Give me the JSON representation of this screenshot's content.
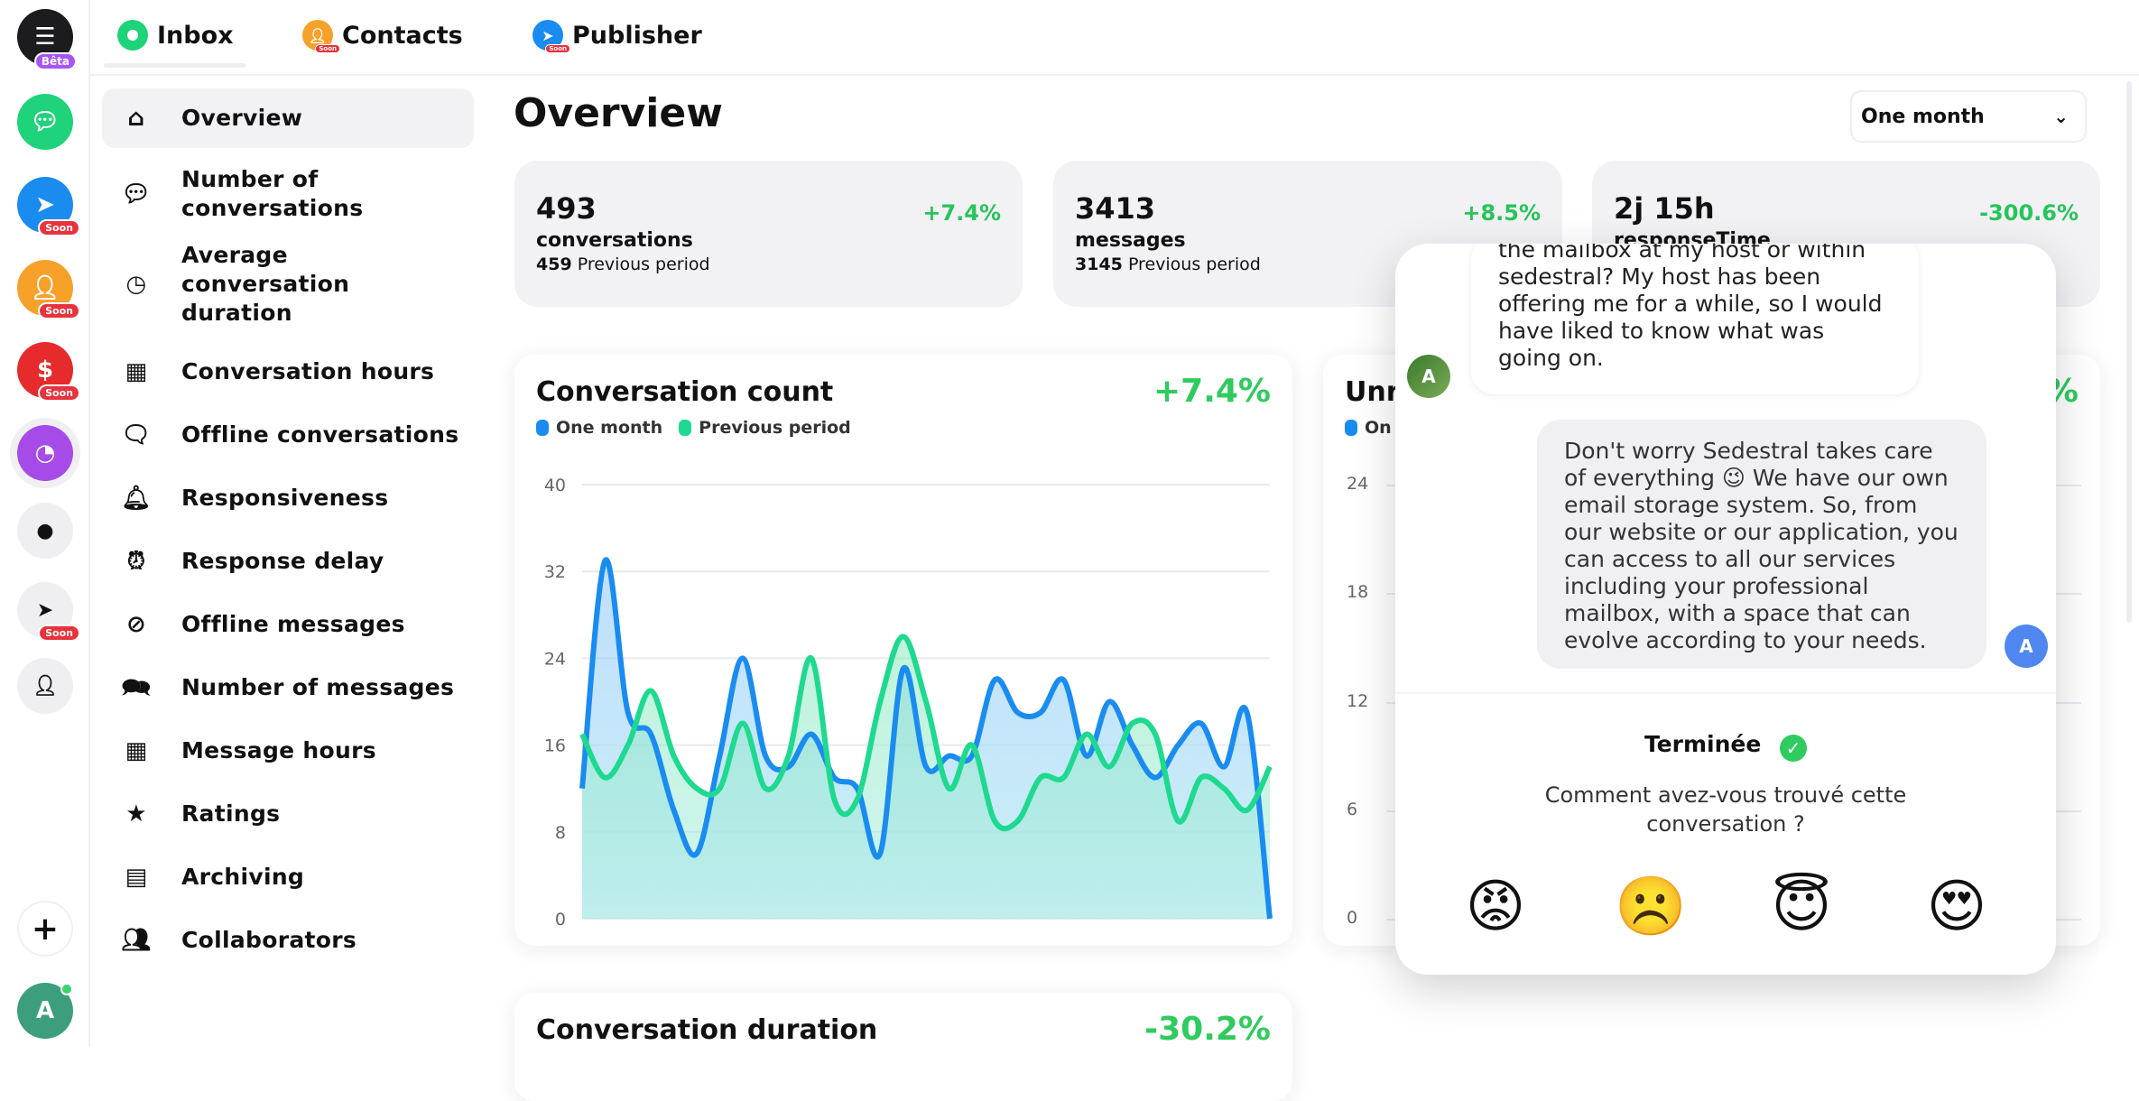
{
  "rail": {
    "beta_badge": "Bêta",
    "soon": "Soon",
    "user_initial": "A",
    "add": "+"
  },
  "topnav": {
    "tabs": [
      {
        "label": "Inbox"
      },
      {
        "label": "Contacts",
        "badge": "Soon"
      },
      {
        "label": "Publisher",
        "badge": "Soon"
      }
    ]
  },
  "sidebar": {
    "items": [
      {
        "label": "Overview",
        "icon": "home-user-icon"
      },
      {
        "label": "Number of conversations",
        "icon": "chat-bubbles-icon"
      },
      {
        "label": "Average conversation duration",
        "icon": "clock-icon"
      },
      {
        "label": "Conversation hours",
        "icon": "calendar-chart-icon"
      },
      {
        "label": "Offline conversations",
        "icon": "chat-x-icon"
      },
      {
        "label": "Responsiveness",
        "icon": "bell-icon"
      },
      {
        "label": "Response delay",
        "icon": "alarm-icon"
      },
      {
        "label": "Offline messages",
        "icon": "chat-blocked-icon"
      },
      {
        "label": "Number of messages",
        "icon": "chat-trend-icon"
      },
      {
        "label": "Message hours",
        "icon": "calendar-bell-icon"
      },
      {
        "label": "Ratings",
        "icon": "user-stars-icon"
      },
      {
        "label": "Archiving",
        "icon": "archive-icon"
      },
      {
        "label": "Collaborators",
        "icon": "team-icon"
      }
    ]
  },
  "main": {
    "title": "Overview",
    "period_select": "One month",
    "stats": [
      {
        "value": "493",
        "label": "conversations",
        "prev_value": "459",
        "prev_label": "Previous period",
        "change": "+7.4%"
      },
      {
        "value": "3413",
        "label": "messages",
        "prev_value": "3145",
        "prev_label": "Previous period",
        "change": "+8.5%"
      },
      {
        "value": "2j 15h",
        "label": "responseTime",
        "change": "-300.6%"
      }
    ],
    "second_chart": {
      "title": "Unr",
      "legend": "On",
      "change": "%",
      "yticks": [
        "24",
        "18",
        "12",
        "6",
        "0"
      ]
    },
    "third_chart": {
      "title": "Conversation duration",
      "change": "-30.2%"
    }
  },
  "chart_data": {
    "type": "area",
    "title": "Conversation count",
    "change": "+7.4%",
    "xlabel": "",
    "ylabel": "",
    "ylim": [
      0,
      40
    ],
    "yticks": [
      "40",
      "32",
      "24",
      "16",
      "8",
      "0"
    ],
    "grid": true,
    "legend_position": "top-left",
    "x": [
      1,
      2,
      3,
      4,
      5,
      6,
      7,
      8,
      9,
      10,
      11,
      12,
      13,
      14,
      15,
      16,
      17,
      18,
      19,
      20,
      21,
      22,
      23,
      24,
      25,
      26,
      27,
      28,
      29,
      30,
      31
    ],
    "series": [
      {
        "name": "One month",
        "color": "#1a8cf0",
        "values": [
          12,
          33,
          19,
          17,
          10,
          6,
          15,
          24,
          15,
          14,
          17,
          13,
          12,
          6,
          23,
          14,
          15,
          15,
          22,
          19,
          19,
          22,
          15,
          20,
          16,
          13,
          16,
          18,
          14,
          19,
          0
        ]
      },
      {
        "name": "Previous period",
        "color": "#1ed98f",
        "values": [
          17,
          13,
          16,
          21,
          15,
          12,
          12,
          18,
          12,
          15,
          24,
          11,
          11,
          20,
          26,
          20,
          12,
          16,
          9,
          9,
          13,
          13,
          17,
          14,
          18,
          17,
          9,
          13,
          12,
          10,
          14
        ]
      }
    ]
  },
  "popup": {
    "message_in": "the mailbox at my host or within sedestral? My host has been offering me for a while, so I would have liked to know what was going on.",
    "message_out": "Don't worry Sedestral takes care of everything 😉 We have our own email storage system. So, from our website or our application, you can access to all our services including your professional mailbox, with a space that can evolve according to your needs.",
    "avatar_in": "A",
    "avatar_out": "A",
    "status": "Terminée",
    "question": "Comment avez-vous trouvé cette conversation ?",
    "ratings": [
      "😡",
      "☹️",
      "😇",
      "😍"
    ]
  }
}
